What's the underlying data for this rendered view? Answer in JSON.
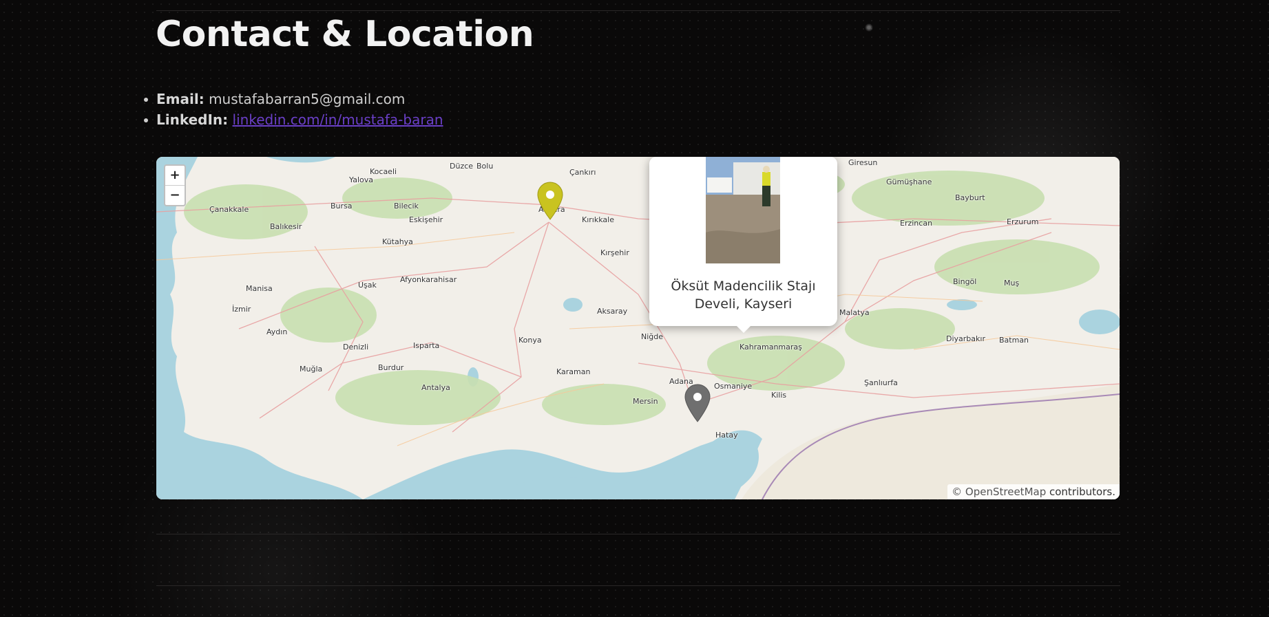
{
  "section": {
    "title": "Contact & Location"
  },
  "contacts": {
    "email": {
      "label": "Email:",
      "value": "mustafabarran5@gmail.com"
    },
    "linkedin": {
      "label": "LinkedIn:",
      "value": "linkedin.com/in/mustafa-baran"
    }
  },
  "map": {
    "zoom_in": "+",
    "zoom_out": "−",
    "attribution_prefix": "© OpenStreetMap",
    "attribution_suffix": " contributors.",
    "popup": {
      "line1": "Öksüt Madencilik Stajı",
      "line2": "Develi, Kayseri"
    },
    "markers": [
      {
        "name": "Ankara",
        "color": "#c9c320"
      },
      {
        "name": "Adana",
        "color": "#6f6f6f"
      }
    ],
    "cities": [
      "Kocaeli",
      "Düzce",
      "Bolu",
      "Yalova",
      "Bursa",
      "Eskişehir",
      "Balıkesir",
      "Kütahya",
      "Manisa",
      "Uşak",
      "Afyonkarahisar",
      "İzmir",
      "Aydın",
      "Muğla",
      "Denizli",
      "Isparta",
      "Antalya",
      "Konya",
      "Karaman",
      "Aksaray",
      "Kırşehir",
      "Mersin",
      "Adana",
      "Osmaniye",
      "Kahramanmaraş",
      "Malatya",
      "Diyarbakır",
      "Batman",
      "Şanlıurfa",
      "Erzurum",
      "Erzincan",
      "Bingöl",
      "Muş",
      "Bayburt",
      "Gümüşhane",
      "Hatay",
      "Kilis",
      "Niğde",
      "Çankırı",
      "Kırıkkale",
      "Ankara",
      "Çanakkale",
      "Bilecik",
      "Burdur",
      "Giresun"
    ],
    "colors": {
      "land": "#f2efe9",
      "sea": "#aad3df",
      "forest": "#c8dfb0",
      "road_major": "#e8a0a0"
    }
  }
}
